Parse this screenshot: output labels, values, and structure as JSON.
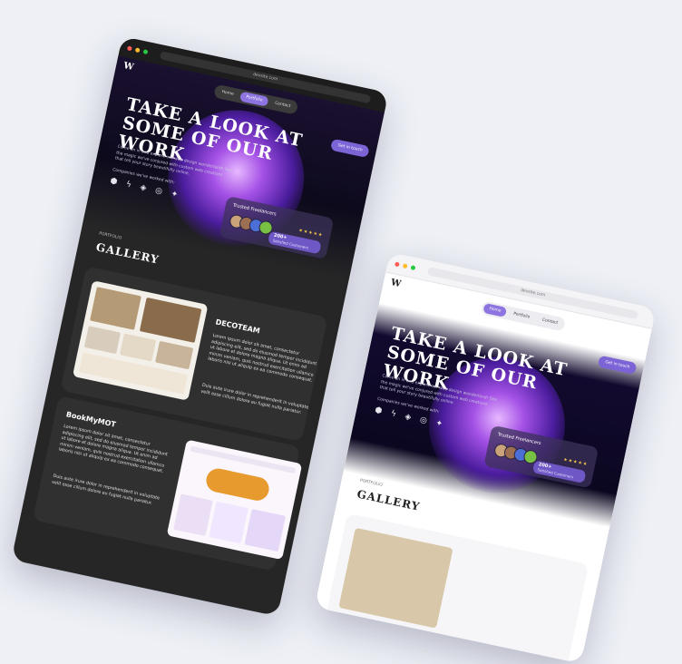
{
  "site": {
    "url": "devsite.com",
    "logo_text": "W",
    "nav": [
      "Home",
      "Portfolio",
      "Contact"
    ],
    "cta": "Get in touch",
    "theme_icon": "moon-icon"
  },
  "hero": {
    "title": "TAKE A LOOK AT SOME OF OUR WORK",
    "subtitle": "Come on in and explore our web design wonderland! See the magic we've conjured with custom web creations that tell your story beautifully online.",
    "worked_with": "Companies we've worked with:",
    "brand_icons": [
      "cube-icon",
      "bolt-icon",
      "layers-icon",
      "ring-icon",
      "sparkle-icon"
    ]
  },
  "rating": {
    "title": "Trusted Freelancers",
    "stars": "★★★★★",
    "count": "200+",
    "label": "Satisfied Customers"
  },
  "gallery": {
    "eyebrow": "PORTFOLIO",
    "title": "GALLERY"
  },
  "projects": [
    {
      "name": "DECOTEAM",
      "desc1": "Lorem ipsum dolor sit amet, consectetur adipiscing elit, sed do eiusmod tempor incididunt ut labore et dolore magna aliqua. Ut enim ad minim veniam, quis nostrud exercitation ullamco laboris nisi ut aliquip ex ea commodo consequat.",
      "desc2": "Duis aute irure dolor in reprehenderit in voluptate velit esse cillum dolore eu fugiat nulla pariatur."
    },
    {
      "name": "BookMyMOT",
      "desc1": "Lorem ipsum dolor sit amet, consectetur adipiscing elit, sed do eiusmod tempor incididunt ut labore et dolore magna aliqua. Ut enim ad minim veniam, quis nostrud exercitation ullamco laboris nisi ut aliquip ex ea commodo consequat.",
      "desc2": "Duis aute irure dolor in reprehenderit in voluptate velit esse cillum dolore eu fugiat nulla pariatur."
    }
  ],
  "colors": {
    "accent": "#7d64d6",
    "dark_bg": "#262626",
    "glow": "#a552e6"
  }
}
